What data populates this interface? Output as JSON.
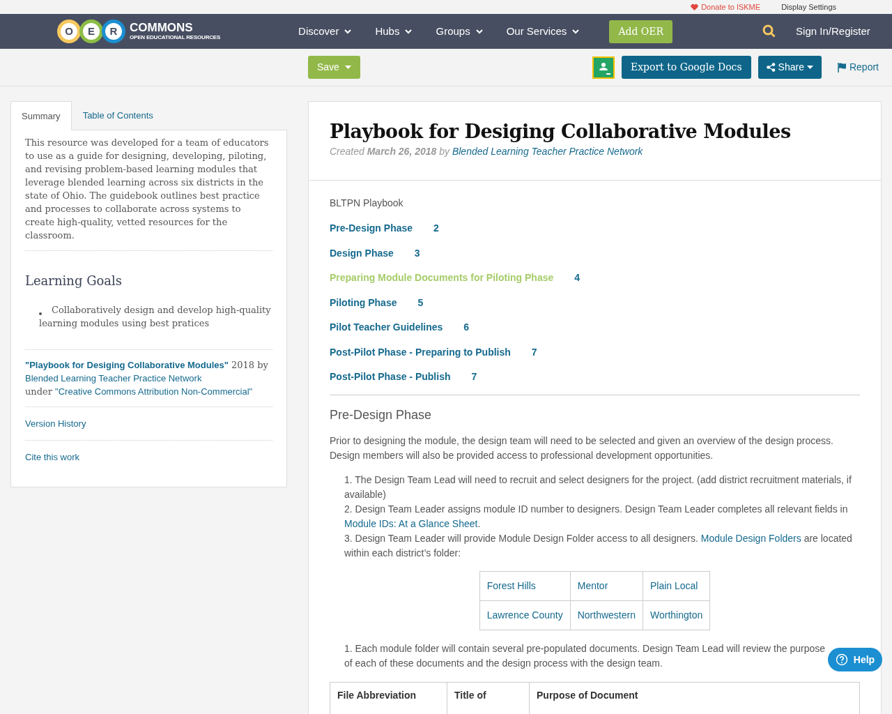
{
  "topbar": {
    "donate": "Donate to ISKME",
    "display_settings": "Display Settings"
  },
  "navbar": {
    "logo": {
      "letters": [
        "O",
        "E",
        "R"
      ],
      "name": "COMMONS",
      "tagline": "OPEN EDUCATIONAL RESOURCES"
    },
    "menu": [
      {
        "label": "Discover"
      },
      {
        "label": "Hubs"
      },
      {
        "label": "Groups"
      },
      {
        "label": "Our Services"
      }
    ],
    "add_button": "Add OER",
    "sign_in": "Sign In/Register"
  },
  "toolbar": {
    "save": "Save",
    "export": "Export to Google Docs",
    "share": "Share",
    "report": "Report"
  },
  "sidebar": {
    "tabs": [
      {
        "label": "Summary",
        "selected": true
      },
      {
        "label": "Table of Contents",
        "selected": false
      }
    ],
    "summary": "This resource was developed for a team of educators to use as a guide for designing, developing, piloting, and revising problem-based learning modules that leverage blended learning across six districts in the state of Ohio. The guidebook outlines best practice and processes to collaborate across systems to create high-quality, vetted resources for the classroom.",
    "learning_goals": {
      "heading": "Learning Goals",
      "items": [
        "Collaboratively design and develop high-quality learning modules using best pratices"
      ]
    },
    "attribution": {
      "title": "\"Playbook for Desiging Collaborative Modules\"",
      "year_by": "2018 by",
      "author": "Blended Learning Teacher Practice Network",
      "under": "under",
      "license": "\"Creative Commons Attribution Non-Commercial\""
    },
    "links": [
      "Version History",
      "Cite this work"
    ]
  },
  "article": {
    "title": "Playbook for Desiging Collaborative Modules",
    "meta": {
      "created": "Created",
      "date": "March 26, 2018",
      "by": "by",
      "author": "Blended Learning Teacher Practice Network"
    },
    "toc": {
      "heading": "BLTPN Playbook",
      "entries": [
        {
          "label": "Pre-Design Phase",
          "page": "2",
          "hovered": false
        },
        {
          "label": "Design Phase",
          "page": "3",
          "hovered": false
        },
        {
          "label": "Preparing Module Documents for Piloting Phase",
          "page": "4",
          "hovered": true
        },
        {
          "label": "Piloting Phase",
          "page": "5",
          "hovered": false
        },
        {
          "label": "Pilot Teacher Guidelines",
          "page": "6",
          "hovered": false
        },
        {
          "label": "Post-Pilot Phase - Preparing to Publish",
          "page": "7",
          "hovered": false
        },
        {
          "label": "Post-Pilot Phase - Publish",
          "page": "7",
          "hovered": false
        }
      ]
    },
    "section": {
      "heading": "Pre-Design Phase",
      "intro": "Prior to designing the module, the design team will need to be selected and given an overview of the design process. Design members will also be provided access to professional development opportunities.",
      "steps": [
        {
          "parts": [
            {
              "kind": "text",
              "text": "1. The Design Team Lead will need to recruit and select designers for the project. (add district recruitment materials, if available)"
            }
          ]
        },
        {
          "parts": [
            {
              "kind": "text",
              "text": "2. Design Team Leader assigns module ID number to designers. Design Team Leader completes all relevant fields in "
            },
            {
              "kind": "link",
              "text": "Module IDs: At a Glance Sheet"
            },
            {
              "kind": "text",
              "text": "."
            }
          ]
        },
        {
          "parts": [
            {
              "kind": "text",
              "text": "3. Design Team Leader will provide Module Design Folder access to all designers. "
            },
            {
              "kind": "link",
              "text": "Module Design Folders"
            },
            {
              "kind": "text",
              "text": " are located within each district’s folder:"
            }
          ]
        }
      ],
      "districts": [
        [
          "Forest Hills",
          "Mentor",
          "Plain Local"
        ],
        [
          "Lawrence County",
          "Northwestern",
          "Worthington"
        ]
      ],
      "steps_after": [
        "1. Each module folder will contain several pre-populated documents. Design Team Lead will review the purpose of each of these documents and the design process with the design team."
      ],
      "docs_table": {
        "columns": [
          "File Abbreviation",
          "Title of",
          "Purpose of Document"
        ]
      }
    }
  },
  "help_button": "Help"
}
